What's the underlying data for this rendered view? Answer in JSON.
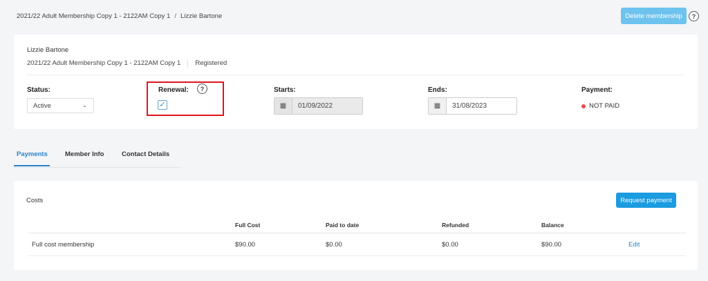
{
  "breadcrumb": {
    "parent": "2021/22 Adult Membership Copy 1 - 2122AM Copy 1",
    "separator": "/",
    "current": "Lizzie Bartone"
  },
  "header": {
    "delete_label": "Delete membership",
    "help_glyph": "?"
  },
  "member": {
    "name": "Lizzie Bartone",
    "membership": "2021/22 Adult Membership Copy 1 - 2122AM Copy 1",
    "state": "Registered"
  },
  "fields": {
    "status": {
      "label": "Status:",
      "value": "Active"
    },
    "renewal": {
      "label": "Renewal:",
      "checked": true,
      "check_glyph": "✓",
      "help_glyph": "?"
    },
    "starts": {
      "label": "Starts:",
      "value": "01/09/2022",
      "disabled": true
    },
    "ends": {
      "label": "Ends:",
      "value": "31/08/2023",
      "disabled": false
    },
    "payment": {
      "label": "Payment:",
      "value": "NOT PAID",
      "status_color": "#e84b4b"
    }
  },
  "tabs": [
    {
      "label": "Payments",
      "active": true
    },
    {
      "label": "Member Info",
      "active": false
    },
    {
      "label": "Contact Details",
      "active": false
    }
  ],
  "costs": {
    "title": "Costs",
    "request_label": "Request payment",
    "columns": [
      "Full Cost",
      "Paid to date",
      "Refunded",
      "Balance"
    ],
    "rows": [
      {
        "name": "Full cost membership",
        "full_cost": "$90.00",
        "paid": "$0.00",
        "refunded": "$0.00",
        "balance": "$90.00",
        "action": "Edit"
      }
    ]
  },
  "colors": {
    "accent": "#2a84c7",
    "primary_button": "#1b9be0",
    "disabled_button": "#6ec3ee",
    "highlight": "#e0141e"
  }
}
